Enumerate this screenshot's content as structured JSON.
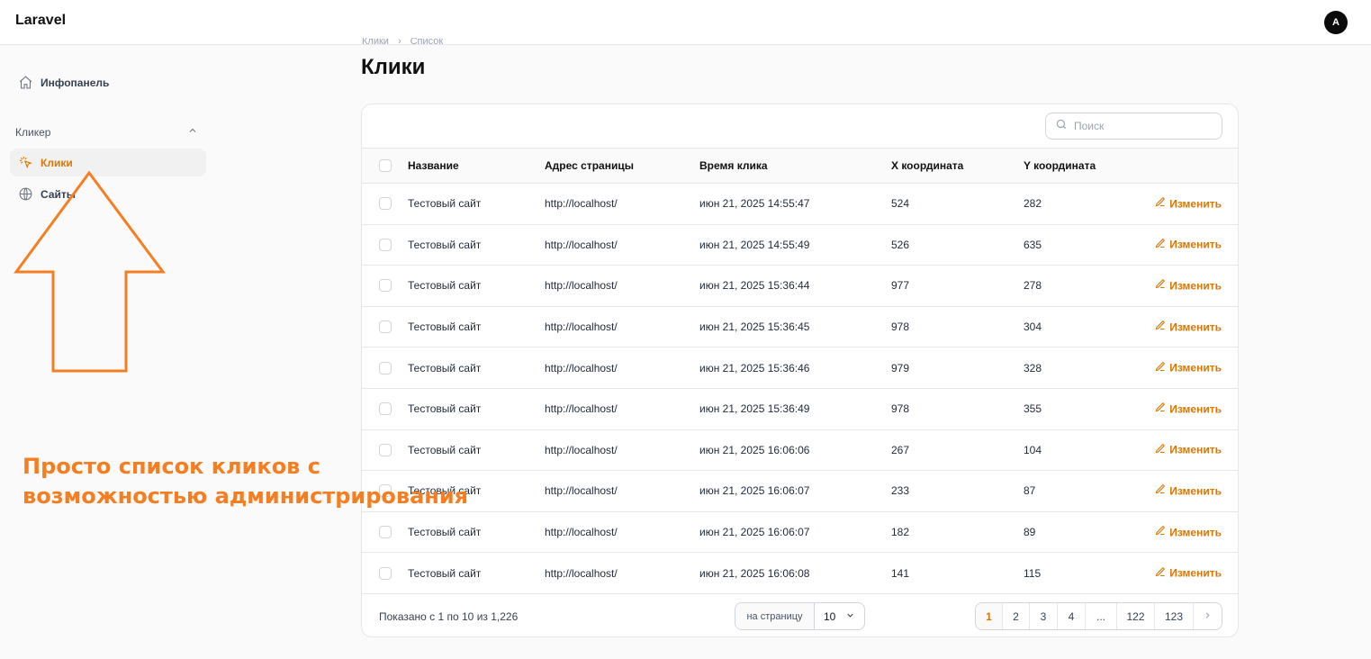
{
  "app": {
    "brand": "Laravel",
    "avatar_initial": "A"
  },
  "sidebar": {
    "dashboard": "Инфопанель",
    "group_label": "Кликер",
    "items": [
      {
        "label": "Клики",
        "active": true
      },
      {
        "label": "Сайты",
        "active": false
      }
    ]
  },
  "breadcrumbs": [
    "Клики",
    "Список"
  ],
  "page": {
    "title": "Клики"
  },
  "search": {
    "placeholder": "Поиск"
  },
  "table": {
    "columns": [
      "Название",
      "Адрес страницы",
      "Время клика",
      "X координата",
      "Y координата"
    ],
    "edit_label": "Изменить",
    "rows": [
      [
        "Тестовый сайт",
        "http://localhost/",
        "июн 21, 2025 14:55:47",
        "524",
        "282"
      ],
      [
        "Тестовый сайт",
        "http://localhost/",
        "июн 21, 2025 14:55:49",
        "526",
        "635"
      ],
      [
        "Тестовый сайт",
        "http://localhost/",
        "июн 21, 2025 15:36:44",
        "977",
        "278"
      ],
      [
        "Тестовый сайт",
        "http://localhost/",
        "июн 21, 2025 15:36:45",
        "978",
        "304"
      ],
      [
        "Тестовый сайт",
        "http://localhost/",
        "июн 21, 2025 15:36:46",
        "979",
        "328"
      ],
      [
        "Тестовый сайт",
        "http://localhost/",
        "июн 21, 2025 15:36:49",
        "978",
        "355"
      ],
      [
        "Тестовый сайт",
        "http://localhost/",
        "июн 21, 2025 16:06:06",
        "267",
        "104"
      ],
      [
        "Тестовый сайт",
        "http://localhost/",
        "июн 21, 2025 16:06:07",
        "233",
        "87"
      ],
      [
        "Тестовый сайт",
        "http://localhost/",
        "июн 21, 2025 16:06:07",
        "182",
        "89"
      ],
      [
        "Тестовый сайт",
        "http://localhost/",
        "июн 21, 2025 16:06:08",
        "141",
        "115"
      ]
    ]
  },
  "footer": {
    "shown_text": "Показано с 1 по 10 из 1,226",
    "per_page_label": "на страницу",
    "per_page_value": "10",
    "pages": [
      "1",
      "2",
      "3",
      "4",
      "...",
      "122",
      "123"
    ],
    "current_page": "1"
  },
  "annotation": {
    "text": "Просто список кликов с возможностью администрирования",
    "color": "#f57e22"
  },
  "colors": {
    "accent": "#d97706"
  }
}
